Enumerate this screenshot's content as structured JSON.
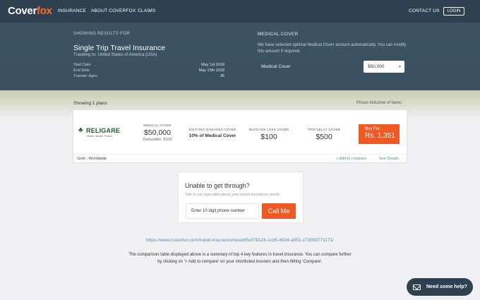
{
  "brand": {
    "logo_main": "Cover",
    "logo_accent": "fox"
  },
  "nav": {
    "links": [
      "INSURANCE",
      "ABOUT COVERFOX",
      "CLAIMS"
    ],
    "contact": "CONTACT US",
    "login": "LOGIN"
  },
  "summary": {
    "showing_label": "SHOWING RESULTS FOR",
    "trip_title": "Single Trip Travel Insurance",
    "traveling_to": "Traveling to: United States of America (USA)",
    "rows": [
      {
        "label": "Start Date",
        "value": "May 1st 2018"
      },
      {
        "label": "End Date",
        "value": "May 15th 2018"
      },
      {
        "label": "Traveler Ages",
        "value": "35"
      }
    ]
  },
  "medical_cover": {
    "title": "MEDICAL COVER",
    "description": "We have selected optimal Medical Cover amount automatically. You can modify this amount if required.",
    "field_label": "Medical Cover",
    "selected": "$50,000"
  },
  "results": {
    "count_text": "Showing 1 plans",
    "prices_note": "Prices inclusive of taxes"
  },
  "plan": {
    "insurer": "RELIGARE",
    "tagline": "Health. Wealth. Protect.",
    "medical_cover_label": "MEDICAL COVER",
    "medical_cover_value": "$50,000",
    "deductible": "Deductible: $100",
    "existing_label": "EXISTING DISEASES COVER",
    "existing_value": "10% of Medical Cover",
    "baggage_label": "BAGGAGE LOSS COVER",
    "baggage_value": "$100",
    "delay_label": "TRIP DELAY COVER",
    "delay_value": "$500",
    "buy_label": "Buy For",
    "price": "Rs. 1,351",
    "plan_name": "Gold - Worldwide",
    "add_compare": "+ Add to compare",
    "see_details": "See Details"
  },
  "callback": {
    "title": "Unable to get through?",
    "subtitle": "Talk to our specialist about your travel insurance needs.",
    "placeholder": "Enter 10 digit phone number",
    "button": "Call Me"
  },
  "footer": {
    "url": "https://www.coverfox.com/travel-insurance/result/5c878124-1cd5-4934-a551-c73093771171/",
    "disclaimer": "The comparison table displayed above is a summary of top 4 key features in travel insurance. You can compare further by clicking on '+ Add to compare' on your shortlisted insurers and then hitting 'Compare'."
  },
  "help": {
    "label": "Need some help?"
  },
  "colors": {
    "nav": "#2f4150",
    "hero": "#3c5363",
    "accent": "#f05a22",
    "link": "#4a90a4"
  }
}
